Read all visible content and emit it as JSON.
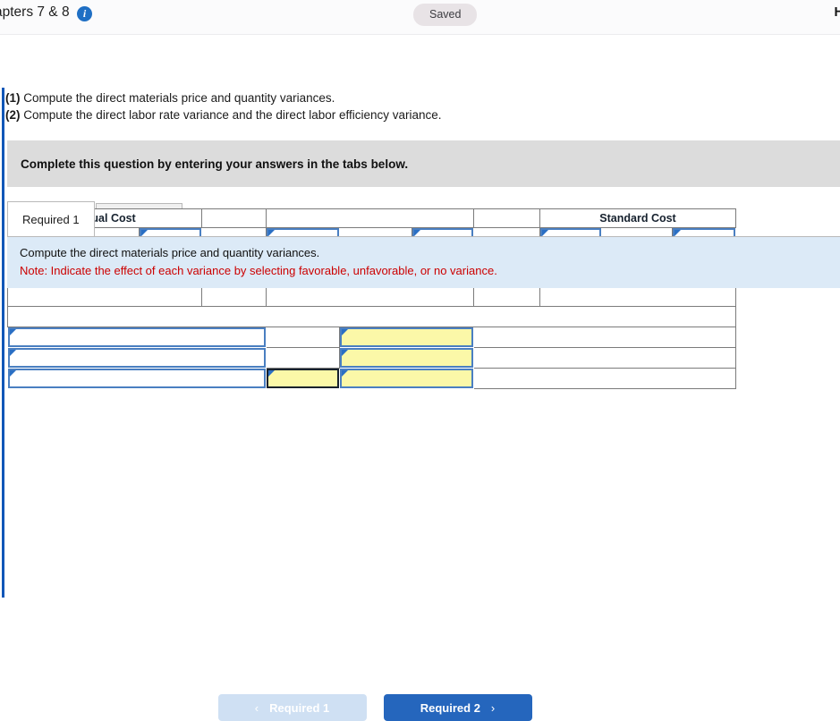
{
  "appbar": {
    "title": "apters 7 & 8",
    "info_icon": "info-icon",
    "saved_label": "Saved",
    "help_label": "He"
  },
  "question": {
    "instructions": [
      {
        "num": "(1)",
        "text": "Compute the direct materials price and quantity variances."
      },
      {
        "num": "(2)",
        "text": "Compute the direct labor rate variance and the direct labor efficiency variance."
      }
    ],
    "complete_banner": "Complete this question by entering your answers in the tabs below."
  },
  "tabs": [
    {
      "label": "Required 1",
      "active": true
    },
    {
      "label": "Required 2",
      "active": false
    }
  ],
  "panel": {
    "prompt": "Compute the direct materials price and quantity variances.",
    "note": "Note: Indicate the effect of each variance by selecting favorable, unfavorable, or no variance."
  },
  "worksheet": {
    "headers": {
      "actual_cost": "Actual Cost",
      "middle": "",
      "standard_cost": "Standard Cost"
    },
    "inputs": {
      "actual_r1_c1": "",
      "actual_r1_c2": "",
      "actual_r1_c3": "",
      "actual_r2_c1": "",
      "actual_r2_c2": "",
      "actual_r2_c3": "",
      "middle_r1_c1": "",
      "middle_r1_c2": "",
      "middle_r1_c3": "",
      "middle_r2_c1": "",
      "middle_r2_c2": "",
      "middle_r2_c3": "",
      "standard_r1_c1": "",
      "standard_r1_c2": "",
      "standard_r1_c3": "",
      "standard_r2_c1": "",
      "standard_r2_c2": "",
      "standard_r2_c3": "",
      "variance_label_1": "",
      "variance_amount_1": "",
      "variance_effect_1": "",
      "variance_label_2": "",
      "variance_amount_2": "",
      "variance_effect_2": "",
      "variance_label_3": "",
      "variance_amount_3": "",
      "variance_effect_3": ""
    }
  },
  "nav": {
    "prev_label": "Required 1",
    "prev_chevron": "‹",
    "next_label": "Required 2",
    "next_chevron": "›"
  },
  "colors": {
    "rail": "#1157b8",
    "header_blue": "#6fa3e0",
    "panel_blue": "#dceaf7",
    "note_red": "#cc0000",
    "input_yellow": "#fbf8a8",
    "btn_active": "#2566bd",
    "btn_disabled": "#cfe0f3"
  }
}
